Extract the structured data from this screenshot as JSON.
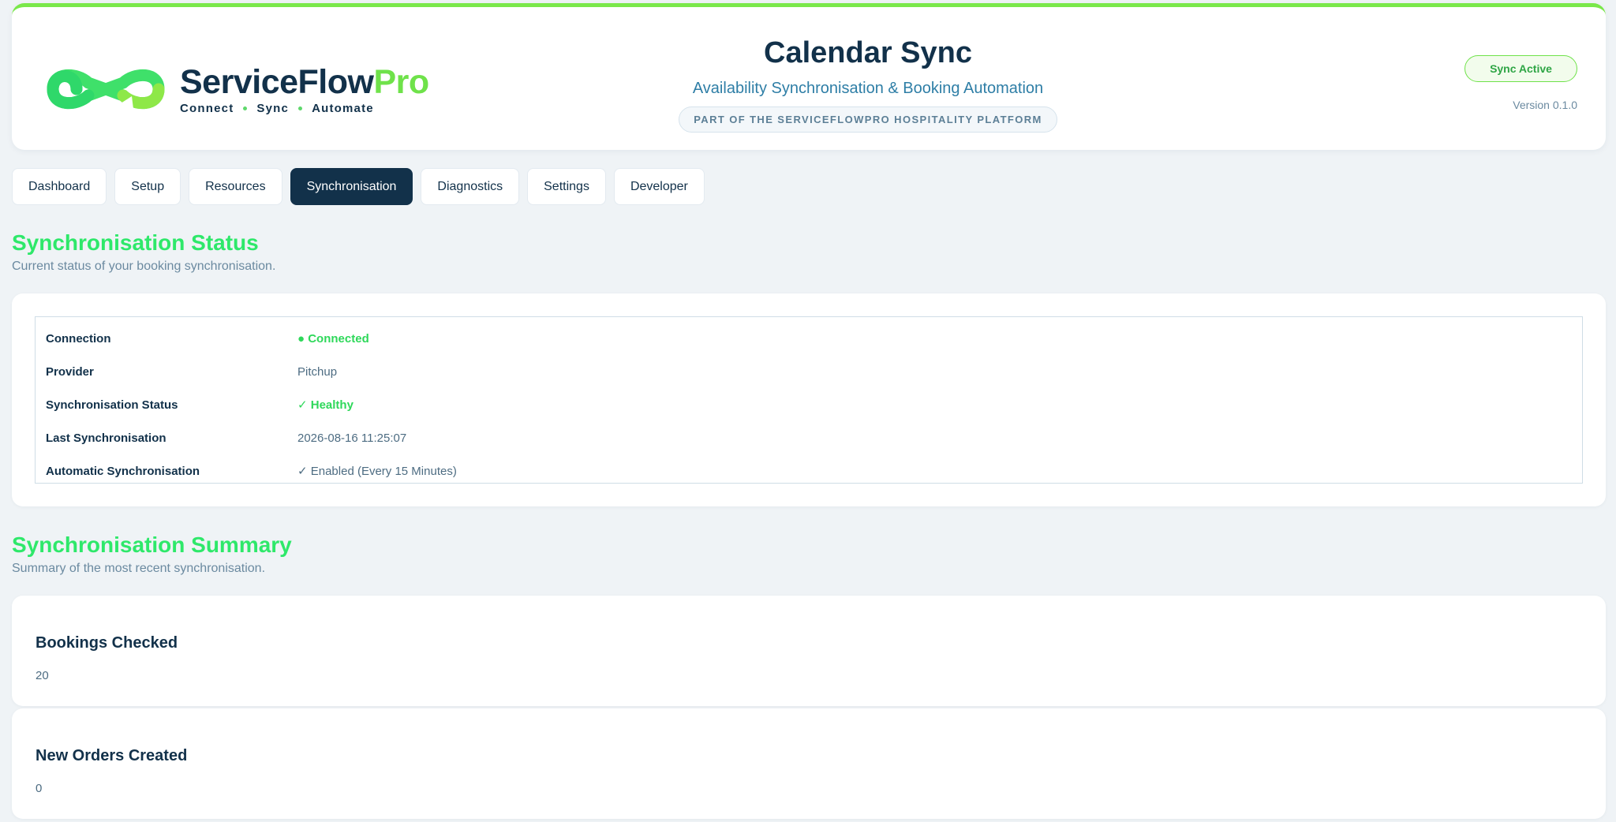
{
  "brand": {
    "name_part1": "ServiceFlow",
    "name_part2": "Pro",
    "tagline": [
      "Connect",
      "Sync",
      "Automate"
    ],
    "colors": {
      "navy": "#12314a",
      "green": "#6fe24a",
      "teal": "#2e7ea6"
    }
  },
  "header": {
    "title": "Calendar Sync",
    "subtitle": "Availability Synchronisation & Booking Automation",
    "platform_badge": "PART OF THE SERVICEFLOWPRO HOSPITALITY PLATFORM",
    "status_pill": "Sync Active",
    "version": "Version 0.1.0"
  },
  "tabs": [
    {
      "label": "Dashboard",
      "active": false
    },
    {
      "label": "Setup",
      "active": false
    },
    {
      "label": "Resources",
      "active": false
    },
    {
      "label": "Synchronisation",
      "active": true
    },
    {
      "label": "Diagnostics",
      "active": false
    },
    {
      "label": "Settings",
      "active": false
    },
    {
      "label": "Developer",
      "active": false
    }
  ],
  "status_section": {
    "title": "Synchronisation Status",
    "description": "Current status of your booking synchronisation.",
    "rows": [
      {
        "label": "Connection",
        "value": "● Connected"
      },
      {
        "label": "Provider",
        "value": "Pitchup"
      },
      {
        "label": "Synchronisation Status",
        "value": "✓ Healthy"
      },
      {
        "label": "Last Synchronisation",
        "value": "2026-08-16 11:25:07"
      },
      {
        "label": "Automatic Synchronisation",
        "value": "✓ Enabled (Every 15 Minutes)"
      }
    ]
  },
  "summary_section": {
    "title": "Synchronisation Summary",
    "description": "Summary of the most recent synchronisation.",
    "metrics": [
      {
        "title": "Bookings Checked",
        "value": "20"
      },
      {
        "title": "New Orders Created",
        "value": "0"
      }
    ]
  }
}
